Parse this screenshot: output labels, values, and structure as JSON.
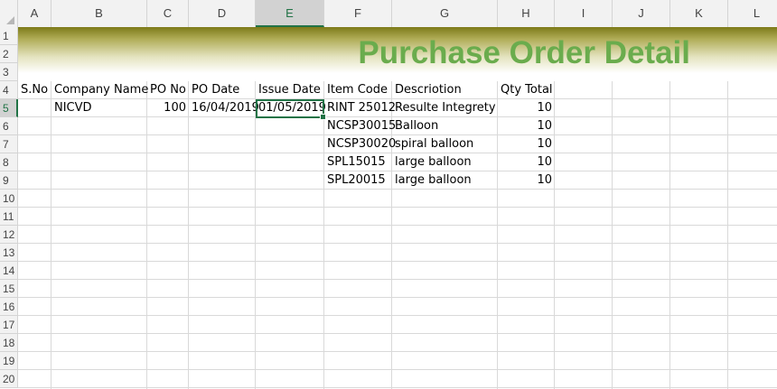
{
  "columns": [
    "A",
    "B",
    "C",
    "D",
    "E",
    "F",
    "G",
    "H",
    "I",
    "J",
    "K",
    "L"
  ],
  "selected_column": "E",
  "rows": [
    "1",
    "2",
    "3",
    "4",
    "5",
    "6",
    "7",
    "8",
    "9",
    "10",
    "11",
    "12",
    "13",
    "14",
    "15",
    "16",
    "17",
    "18",
    "19",
    "20"
  ],
  "selected_row": "5",
  "banner": {
    "title": "Purchase Order Detail",
    "title_color": "#6aac4d",
    "gradient_top": "#7d7a19"
  },
  "table": {
    "headers": [
      "S.No",
      "Company Name",
      "PO No",
      "PO Date",
      "Issue Date",
      "Item Code",
      "Descriotion",
      "Qty Total"
    ],
    "rows": [
      [
        "",
        "NICVD",
        "100",
        "16/04/2019",
        "01/05/2019",
        "RINT 25012",
        "Resulte Integrety",
        "10"
      ],
      [
        "",
        "",
        "",
        "",
        "",
        "NCSP30015",
        "Balloon",
        "10"
      ],
      [
        "",
        "",
        "",
        "",
        "",
        "NCSP30020",
        "spiral balloon",
        "10"
      ],
      [
        "",
        "",
        "",
        "",
        "",
        "SPL15015",
        "large balloon",
        "10"
      ],
      [
        "",
        "",
        "",
        "",
        "",
        "SPL20015",
        "large balloon",
        "10"
      ]
    ]
  },
  "active_cell": "E5",
  "accent_color": "#217346"
}
